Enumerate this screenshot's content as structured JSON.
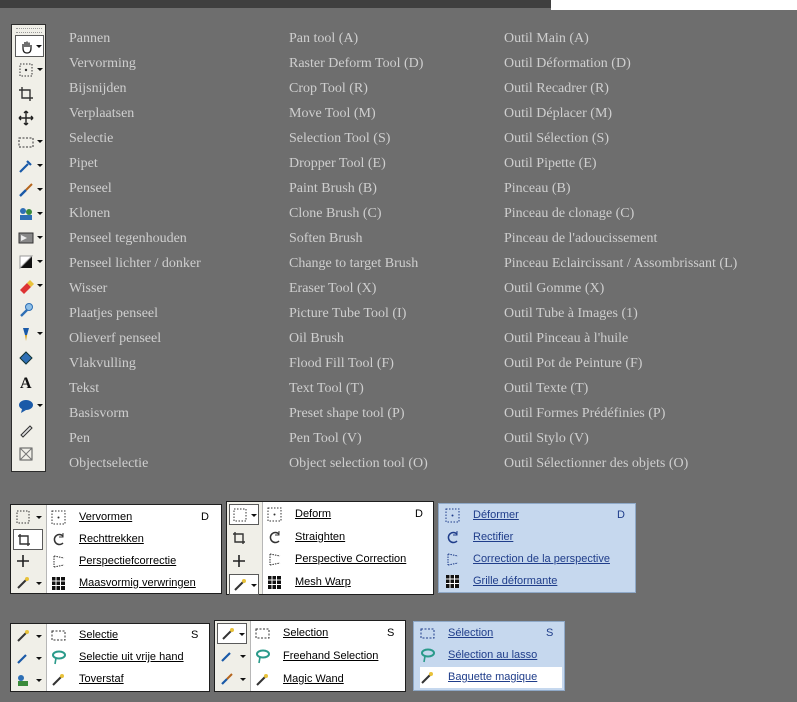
{
  "tool_rows": [
    {
      "nl": "Pannen",
      "en": "Pan tool (A)",
      "fr": "Outil Main (A)"
    },
    {
      "nl": "Vervorming",
      "en": "Raster Deform Tool (D)",
      "fr": "Outil Déformation (D)"
    },
    {
      "nl": "Bijsnijden",
      "en": "Crop Tool (R)",
      "fr": "Outil Recadrer (R)"
    },
    {
      "nl": "Verplaatsen",
      "en": "Move Tool (M)",
      "fr": "Outil Déplacer (M)"
    },
    {
      "nl": "Selectie",
      "en": "Selection Tool (S)",
      "fr": "Outil Sélection (S)"
    },
    {
      "nl": "Pipet",
      "en": "Dropper Tool (E)",
      "fr": "Outil Pipette (E)"
    },
    {
      "nl": "Penseel",
      "en": "Paint Brush (B)",
      "fr": "Pinceau (B)"
    },
    {
      "nl": "Klonen",
      "en": "Clone Brush (C)",
      "fr": "Pinceau de clonage (C)"
    },
    {
      "nl": "Penseel tegenhouden",
      "en": "Soften Brush",
      "fr": "Pinceau de l'adoucissement"
    },
    {
      "nl": "Penseel lichter / donker",
      "en": "Change to target Brush",
      "fr": "Pinceau Eclaircissant / Assombrissant (L)"
    },
    {
      "nl": "Wisser",
      "en": "Eraser Tool (X)",
      "fr": "Outil Gomme (X)"
    },
    {
      "nl": "Plaatjes penseel",
      "en": "Picture Tube Tool (I)",
      "fr": "Outil Tube à Images (1)"
    },
    {
      "nl": "Olieverf penseel",
      "en": "Oil Brush",
      "fr": "Outil Pinceau à l'huile"
    },
    {
      "nl": "Vlakvulling",
      "en": "Flood Fill Tool (F)",
      "fr": "Outil Pot de Peinture (F)"
    },
    {
      "nl": "Tekst",
      "en": "Text Tool (T)",
      "fr": "Outil Texte (T)"
    },
    {
      "nl": "Basisvorm",
      "en": "Preset shape tool (P)",
      "fr": "Outil Formes Prédéfinies (P)"
    },
    {
      "nl": "Pen",
      "en": "Pen Tool (V)",
      "fr": "Outil Stylo (V)"
    },
    {
      "nl": "Objectselectie",
      "en": "Object selection tool (O)",
      "fr": "Outil Sélectionner des objets (O)"
    }
  ],
  "toolbar_icons": [
    "pan-icon",
    "deform-icon",
    "crop-icon",
    "move-icon",
    "selection-icon",
    "dropper-icon",
    "paint-brush-icon",
    "clone-brush-icon",
    "soften-brush-icon",
    "lighten-darken-icon",
    "eraser-icon",
    "picture-tube-icon",
    "oil-brush-icon",
    "flood-fill-icon",
    "text-icon",
    "preset-shape-icon",
    "pen-icon",
    "object-selection-icon"
  ],
  "deform_menu_nl": {
    "items": [
      {
        "label": "Vervormen",
        "shortcut": "D"
      },
      {
        "label": "Rechttrekken",
        "shortcut": ""
      },
      {
        "label": "Perspectiefcorrectie",
        "shortcut": ""
      },
      {
        "label": "Maasvormig verwringen",
        "shortcut": ""
      }
    ]
  },
  "deform_menu_en": {
    "items": [
      {
        "label": "Deform",
        "shortcut": "D"
      },
      {
        "label": "Straighten",
        "shortcut": ""
      },
      {
        "label": "Perspective Correction",
        "shortcut": ""
      },
      {
        "label": "Mesh Warp",
        "shortcut": ""
      }
    ]
  },
  "deform_menu_fr": {
    "items": [
      {
        "label": "Déformer",
        "shortcut": "D"
      },
      {
        "label": "Rectifier",
        "shortcut": ""
      },
      {
        "label": "Correction de la perspective",
        "shortcut": ""
      },
      {
        "label": "Grille déformante",
        "shortcut": ""
      }
    ]
  },
  "select_menu_nl": {
    "items": [
      {
        "label": "Selectie",
        "shortcut": "S"
      },
      {
        "label": "Selectie uit vrije hand",
        "shortcut": ""
      },
      {
        "label": "Toverstaf",
        "shortcut": ""
      }
    ]
  },
  "select_menu_en": {
    "items": [
      {
        "label": "Selection",
        "shortcut": "S"
      },
      {
        "label": "Freehand Selection",
        "shortcut": ""
      },
      {
        "label": "Magic Wand",
        "shortcut": ""
      }
    ]
  },
  "select_menu_fr": {
    "items": [
      {
        "label": "Sélection",
        "shortcut": "S"
      },
      {
        "label": "Sélection au lasso",
        "shortcut": ""
      },
      {
        "label": "Baguette magique",
        "shortcut": ""
      }
    ]
  },
  "colors": {
    "background": "#6e6e6e",
    "text": "#cfcfcf",
    "menu_blue": "#c6d8ee",
    "menu_blue_text": "#1f3d8a"
  }
}
